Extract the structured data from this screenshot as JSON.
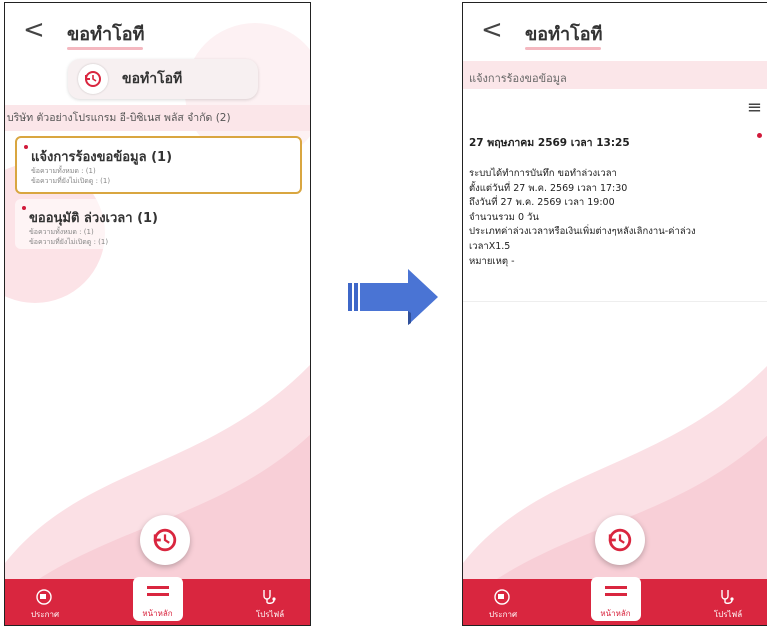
{
  "colors": {
    "brand": "#d9263f",
    "accent_border": "#d9a640",
    "soft_pink": "#fbe6e9",
    "arrow": "#3e67c8"
  },
  "left_screen": {
    "back_glyph": "<",
    "title": "ขอทำโอที",
    "pill_label": "ขอทำโอที",
    "company": "บริษัท ตัวอย่างโปรแกรม อี-บิซิเนส พลัส จำกัด (2)",
    "cards": [
      {
        "title": "แจ้งการร้องขอข้อมูล (1)",
        "line1": "ข้อความทั้งหมด : (1)",
        "line2": "ข้อความที่ยังไม่เปิดดู : (1)"
      },
      {
        "title": "ขออนุมัติ ล่วงเวลา (1)",
        "line1": "ข้อความทั้งหมด : (1)",
        "line2": "ข้อความที่ยังไม่เปิดดู : (1)"
      }
    ],
    "tabs": {
      "left": "ประกาศ",
      "center": "หน้าหลัก",
      "right": "โปรไฟล์"
    }
  },
  "right_screen": {
    "back_glyph": "<",
    "title": "ขอทำโอที",
    "subheader": "แจ้งการร้องขอข้อมูล",
    "menu_glyph": "≡",
    "detail": {
      "date": "27 พฤษภาคม 2569 เวลา 13:25",
      "lines": [
        "ระบบได้ทำการบันทึก ขอทำล่วงเวลา",
        "ตั้งแต่วันที่ 27 พ.ค. 2569 เวลา 17:30",
        "ถึงวันที่ 27 พ.ค. 2569 เวลา 19:00",
        "จำนวนรวม 0 วัน",
        "ประเภทค่าล่วงเวลาหรือเงินเพิ่มต่างๆหลังเลิกงาน-ค่าล่วง",
        "เวลาX1.5",
        "หมายเหตุ -"
      ]
    },
    "tabs": {
      "left": "ประกาศ",
      "center": "หน้าหลัก",
      "right": "โปรไฟล์"
    }
  },
  "icons": {
    "back": "chevron-left-icon",
    "ot_clock": "clock-back-icon",
    "announce": "megaphone-icon",
    "home": "hamburger-icon",
    "profile": "stethoscope-icon",
    "arrow": "right-arrow-icon"
  }
}
